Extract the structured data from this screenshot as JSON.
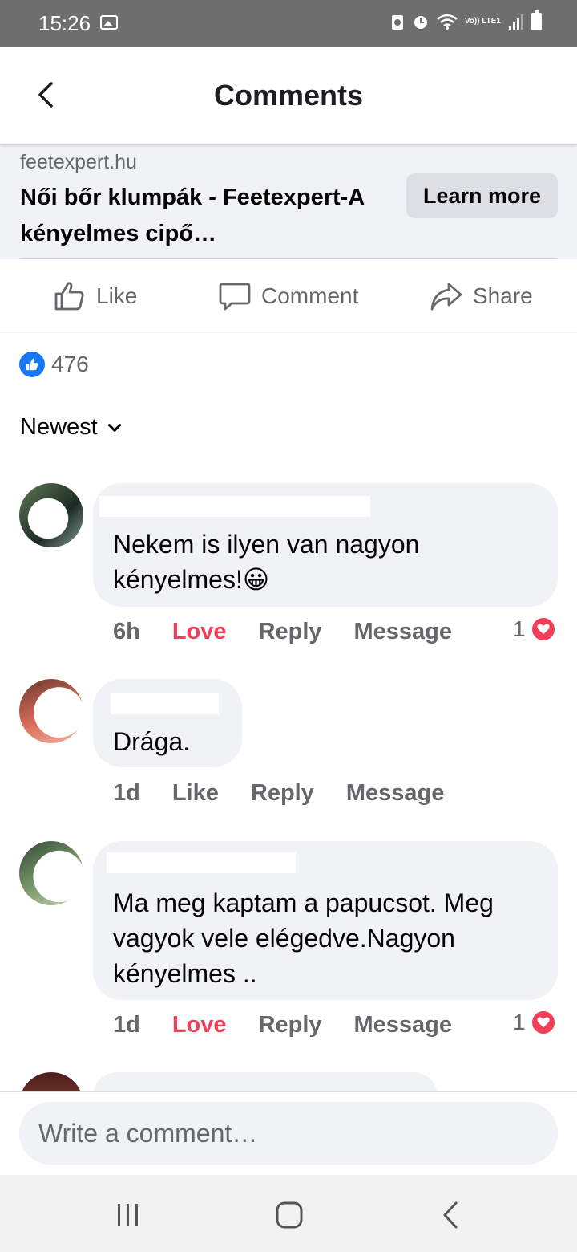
{
  "status_bar": {
    "time": "15:26",
    "network_label": "Vo)) LTE1"
  },
  "header": {
    "title": "Comments",
    "back_icon": "chevron-left-icon"
  },
  "link_preview": {
    "domain": "feetexpert.hu",
    "title": "Női bőr klumpák - Feetexpert-A kényelmes cipő…",
    "button_label": "Learn more"
  },
  "actions": {
    "like_label": "Like",
    "comment_label": "Comment",
    "share_label": "Share"
  },
  "reactions": {
    "count": "476"
  },
  "sort": {
    "label": "Newest"
  },
  "comments": [
    {
      "text": "Nekem is ilyen van nagyon kényelmes!😀",
      "time": "6h",
      "reaction_label": "Love",
      "reply_label": "Reply",
      "message_label": "Message",
      "reaction_count": "1"
    },
    {
      "text": "Drága.",
      "time": "1d",
      "reaction_label": "Like",
      "reply_label": "Reply",
      "message_label": "Message"
    },
    {
      "text": "Ma meg kaptam a papucsot. Meg vagyok vele elégedve.Nagyon kényelmes ..",
      "time": "1d",
      "reaction_label": "Love",
      "reply_label": "Reply",
      "message_label": "Message",
      "reaction_count": "1"
    }
  ],
  "composer": {
    "placeholder": "Write a comment…"
  },
  "colors": {
    "love": "#f33e58",
    "like_blue": "#1877f2",
    "bubble": "#f0f2f5",
    "secondary_text": "#65676b"
  }
}
